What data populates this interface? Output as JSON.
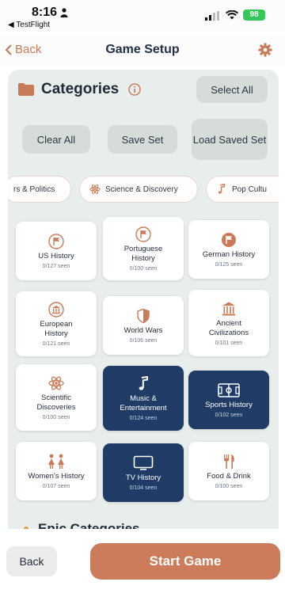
{
  "status": {
    "time": "8:16",
    "back_app": "◀ TestFlight",
    "battery": "98"
  },
  "nav": {
    "back": "Back",
    "title": "Game Setup"
  },
  "categories": {
    "title": "Categories",
    "select_all": "Select All",
    "clear_all": "Clear All",
    "save_set": "Save Set",
    "load_saved_set": "Load Saved Set"
  },
  "chips": [
    {
      "label": "rs & Politics"
    },
    {
      "label": "Science & Discovery",
      "icon": "atom-icon"
    },
    {
      "label": "Pop Cultu",
      "icon": "music-note-icon"
    }
  ],
  "cards": [
    {
      "title": "US History",
      "seen": "0/127 seen",
      "icon": "flag-icon",
      "selected": false
    },
    {
      "title": "Portuguese History",
      "seen": "0/100 seen",
      "icon": "flag-icon",
      "selected": false
    },
    {
      "title": "German History",
      "seen": "0/125 seen",
      "icon": "flag-icon",
      "selected": false
    },
    {
      "title": "European History",
      "seen": "0/121 seen",
      "icon": "bank-icon",
      "selected": false
    },
    {
      "title": "World Wars",
      "seen": "0/106 seen",
      "icon": "shield-icon",
      "selected": false
    },
    {
      "title": "Ancient Civilizations",
      "seen": "0/101 seen",
      "icon": "columns-icon",
      "selected": false
    },
    {
      "title": "Scientific Discoveries",
      "seen": "0/100 seen",
      "icon": "atom-icon",
      "selected": false
    },
    {
      "title": "Music & Entertainment",
      "seen": "0/124 seen",
      "icon": "music-note-icon",
      "selected": true
    },
    {
      "title": "Sports History",
      "seen": "0/102 seen",
      "icon": "soccer-field-icon",
      "selected": true
    },
    {
      "title": "Women's History",
      "seen": "0/107 seen",
      "icon": "women-icon",
      "selected": false
    },
    {
      "title": "TV History",
      "seen": "0/104 seen",
      "icon": "tv-icon",
      "selected": true
    },
    {
      "title": "Food & Drink",
      "seen": "0/100 seen",
      "icon": "fork-knife-icon",
      "selected": false
    }
  ],
  "epic": {
    "title": "Epic Categories"
  },
  "footer": {
    "back": "Back",
    "start": "Start Game"
  },
  "colors": {
    "accent": "#cc7b5b",
    "selected": "#1f3b66",
    "panel": "#e8eeeb"
  }
}
